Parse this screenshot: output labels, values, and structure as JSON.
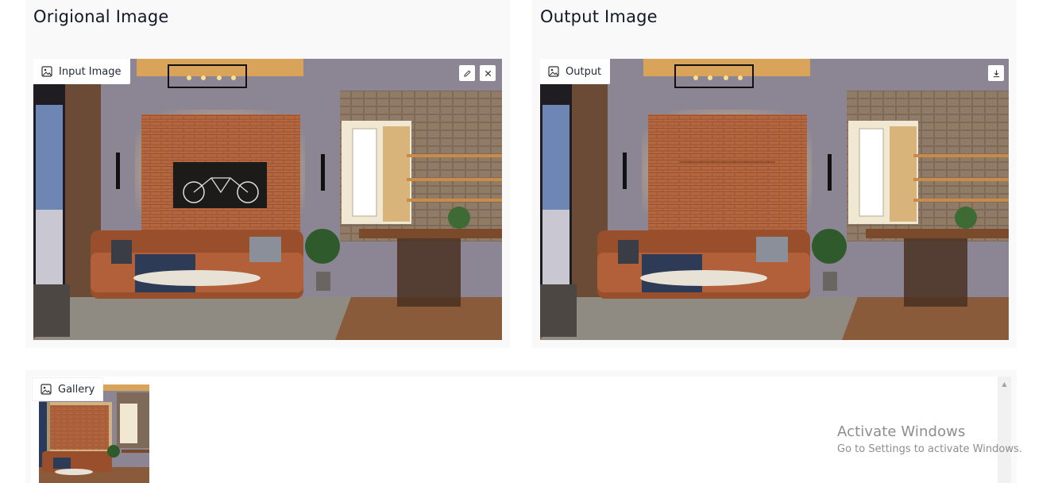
{
  "input_panel": {
    "title": "Origional Image",
    "chip_label": "Input Image",
    "chip_icon": "image-icon",
    "edit_icon": "pencil-icon",
    "clear_icon": "close-icon"
  },
  "output_panel": {
    "title": "Output Image",
    "chip_label": "Output",
    "chip_icon": "image-icon",
    "download_icon": "download-icon"
  },
  "gallery": {
    "chip_label": "Gallery",
    "chip_icon": "image-icon",
    "scroll_icon": "chevron-up-icon"
  },
  "watermark": {
    "title": "Activate Windows",
    "subtitle": "Go to Settings to activate Windows."
  },
  "colors": {
    "panel_bg": "#f9f9f9",
    "wall_brick": "#b5683f",
    "wall_glow": "#ffd27a",
    "sofa": "#9a4f2c",
    "floor": "#8a5b3a"
  }
}
